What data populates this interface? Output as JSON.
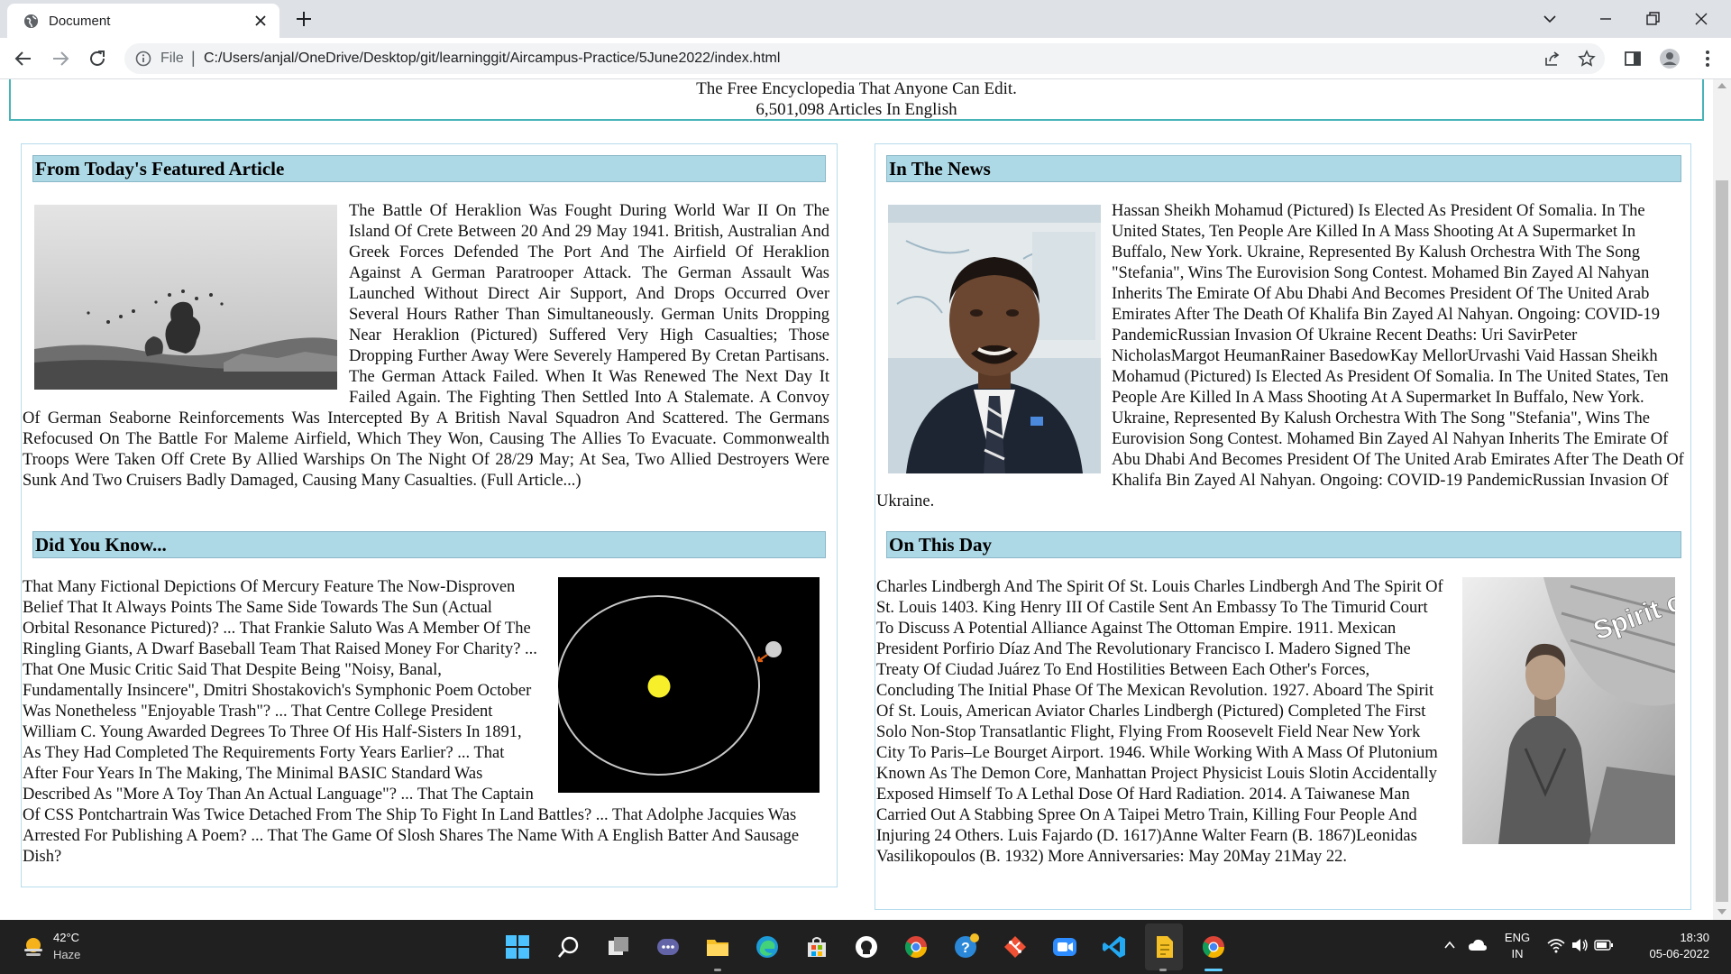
{
  "browser": {
    "tab_title": "Document",
    "omnibox_scheme": "File",
    "url": "C:/Users/anjal/OneDrive/Desktop/git/learninggit/Aircampus-Practice/5June2022/index.html"
  },
  "page": {
    "tagline": "The Free Encyclopedia That Anyone Can Edit.",
    "article_count": "6,501,098 Articles In English"
  },
  "featured": {
    "title": "From Today's Featured Article",
    "text": "The Battle Of Heraklion Was Fought During World War II On The Island Of Crete Between 20 And 29 May 1941. British, Australian And Greek Forces Defended The Port And The Airfield Of Heraklion Against A German Paratrooper Attack. The German Assault Was Launched Without Direct Air Support, And Drops Occurred Over Several Hours Rather Than Simultaneously. German Units Dropping Near Heraklion (Pictured) Suffered Very High Casualties; Those Dropping Further Away Were Severely Hampered By Cretan Partisans. The German Attack Failed. When It Was Renewed The Next Day It Failed Again. The Fighting Then Settled Into A Stalemate. A Convoy Of German Seaborne Reinforcements Was Intercepted By A British Naval Squadron And Scattered. The Germans Refocused On The Battle For Maleme Airfield, Which They Won, Causing The Allies To Evacuate. Commonwealth Troops Were Taken Off Crete By Allied Warships On The Night Of 28/29 May; At Sea, Two Allied Destroyers Were Sunk And Two Cruisers Badly Damaged, Causing Many Casualties. (Full Article...)"
  },
  "dyk": {
    "title": "Did You Know...",
    "text": "That Many Fictional Depictions Of Mercury Feature The Now-Disproven Belief That It Always Points The Same Side Towards The Sun (Actual Orbital Resonance Pictured)? ... That Frankie Saluto Was A Member Of The Ringling Giants, A Dwarf Baseball Team That Raised Money For Charity? ... That One Music Critic Said That Despite Being \"Noisy, Banal, Fundamentally Insincere\", Dmitri Shostakovich's Symphonic Poem October Was Nonetheless \"Enjoyable Trash\"? ... That Centre College President William C. Young Awarded Degrees To Three Of His Half-Sisters In 1891, As They Had Completed The Requirements Forty Years Earlier? ... That After Four Years In The Making, The Minimal BASIC Standard Was Described As \"More A Toy Than An Actual Language\"? ... That The Captain Of CSS Pontchartrain Was Twice Detached From The Ship To Fight In Land Battles? ... That Adolphe Jacquies Was Arrested For Publishing A Poem? ... That The Game Of Slosh Shares The Name With A English Batter And Sausage Dish?"
  },
  "news": {
    "title": "In The News",
    "text": "Hassan Sheikh Mohamud (Pictured) Is Elected As President Of Somalia. In The United States, Ten People Are Killed In A Mass Shooting At A Supermarket In Buffalo, New York. Ukraine, Represented By Kalush Orchestra With The Song \"Stefania\", Wins The Eurovision Song Contest. Mohamed Bin Zayed Al Nahyan Inherits The Emirate Of Abu Dhabi And Becomes President Of The United Arab Emirates After The Death Of Khalifa Bin Zayed Al Nahyan. Ongoing: COVID-19 PandemicRussian Invasion Of Ukraine Recent Deaths: Uri SavirPeter NicholasMargot HeumanRainer BasedowKay MellorUrvashi Vaid Hassan Sheikh Mohamud (Pictured) Is Elected As President Of Somalia. In The United States, Ten People Are Killed In A Mass Shooting At A Supermarket In Buffalo, New York. Ukraine, Represented By Kalush Orchestra With The Song \"Stefania\", Wins The Eurovision Song Contest. Mohamed Bin Zayed Al Nahyan Inherits The Emirate Of Abu Dhabi And Becomes President Of The United Arab Emirates After The Death Of Khalifa Bin Zayed Al Nahyan. Ongoing: COVID-19 PandemicRussian Invasion Of Ukraine."
  },
  "otd": {
    "title": "On This Day",
    "text": "Charles Lindbergh And The Spirit Of St. Louis Charles Lindbergh And The Spirit Of St. Louis 1403. King Henry III Of Castile Sent An Embassy To The Timurid Court To Discuss A Potential Alliance Against The Ottoman Empire. 1911. Mexican President Porfirio Díaz And The Revolutionary Francisco I. Madero Signed The Treaty Of Ciudad Juárez To End Hostilities Between Each Other's Forces, Concluding The Initial Phase Of The Mexican Revolution. 1927. Aboard The Spirit Of St. Louis, American Aviator Charles Lindbergh (Pictured) Completed The First Solo Non-Stop Transatlantic Flight, Flying From Roosevelt Field Near New York City To Paris–Le Bourget Airport. 1946. While Working With A Mass Of Plutonium Known As The Demon Core, Manhattan Project Physicist Louis Slotin Accidentally Exposed Himself To A Lethal Dose Of Hard Radiation. 2014. A Taiwanese Man Carried Out A Stabbing Spree On A Taipei Metro Train, Killing Four People And Injuring 24 Others. Luis Fajardo (D. 1617)Anne Walter Fearn (B. 1867)Leonidas Vasilikopoulos (B. 1932) More Anniversaries: May 20May 21May 22."
  },
  "plane_caption": "Spirit of St. Louis",
  "taskbar": {
    "temperature": "42°C",
    "weather": "Haze",
    "lang_line1": "ENG",
    "lang_line2": "IN",
    "time": "18:30",
    "date": "05-06-2022"
  },
  "colors": {
    "section_header_bg": "#add8e6",
    "header_border": "#48b4b8",
    "panel_border": "#b6dcec",
    "taskbar_bg": "#202020"
  }
}
